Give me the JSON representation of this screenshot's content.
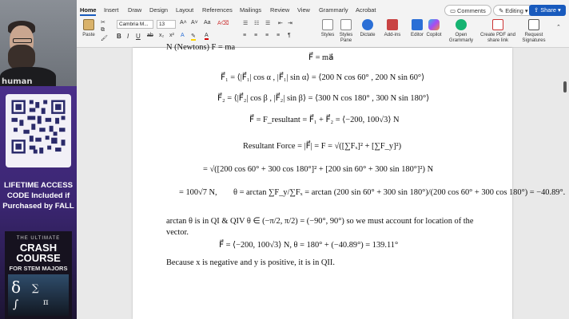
{
  "window": {
    "tabs": [
      "Home",
      "Insert",
      "Draw",
      "Design",
      "Layout",
      "References",
      "Mailings",
      "Review",
      "View",
      "Grammarly",
      "Acrobat"
    ],
    "comments_label": "Comments",
    "editing_label": "Editing",
    "share_label": "Share"
  },
  "ribbon": {
    "paste_label": "Paste",
    "font_name": "Cambria M...",
    "font_size": "13",
    "styles_label": "Styles",
    "styles_pane_label": "Styles Pane",
    "dictate_label": "Dictate",
    "addins_label": "Add-ins",
    "editor_label": "Editor",
    "copilot_label": "Copilot",
    "grammarly_label": "Open Grammarly",
    "pdf_label": "Create PDF and share link",
    "signatures_label": "Request Signatures"
  },
  "sidebar": {
    "shirt_text": "human",
    "promo_text": "LIFETIME ACCESS CODE Included if Purchased by FALL",
    "book_top": "THE ULTIMATE",
    "book_title": "CRASH COURSE",
    "book_sub": "FOR STEM MAJORS"
  },
  "document": {
    "line_top": "N (Newtons) F = ma",
    "eq_fma": "F⃗ = ma⃗",
    "eq_f1": "F⃗₁ = ⟨|F⃗₁| cos α , |F⃗₁| sin α⟩ = ⟨200 N cos 60° , 200 N sin 60°⟩",
    "eq_f2": "F⃗₂ = ⟨|F⃗₂| cos β , |F⃗₂| sin β⟩ = ⟨300 N cos 180° , 300 N sin 180°⟩",
    "eq_fres": "F⃗ = F_resultant = F⃗₁ + F⃗₂ = ⟨−200, 100√3⟩ N",
    "eq_resultant_label": "Resultant Force = |F⃗| = F = √([∑Fₓ]² + [∑F_y]²)",
    "eq_long": "= √([200 cos 60° + 300 cos 180°]² + [200 sin 60° + 300 sin 180°]²) N",
    "eq_mag": "= 100√7 N,",
    "eq_theta": "θ = arctan ∑F_y/∑Fₓ = arctan (200 sin 60° + 300 sin 180°)/(200 cos 60° + 300 cos 180°) = −40.89°.",
    "para_arctan": "arctan θ is in QI & QIV θ ∈ (−π/2, π/2) = (−90°, 90°) so we must account for location of the",
    "para_vector": "vector.",
    "eq_final": "F⃗ = ⟨−200, 100√3⟩ N,      θ = 180° + (−40.89°) = 139.11°",
    "para_last": "Because x is negative and y is positive, it is in QII."
  },
  "colors": {
    "accent": "#185abd",
    "promo": "#4a2f8a"
  }
}
